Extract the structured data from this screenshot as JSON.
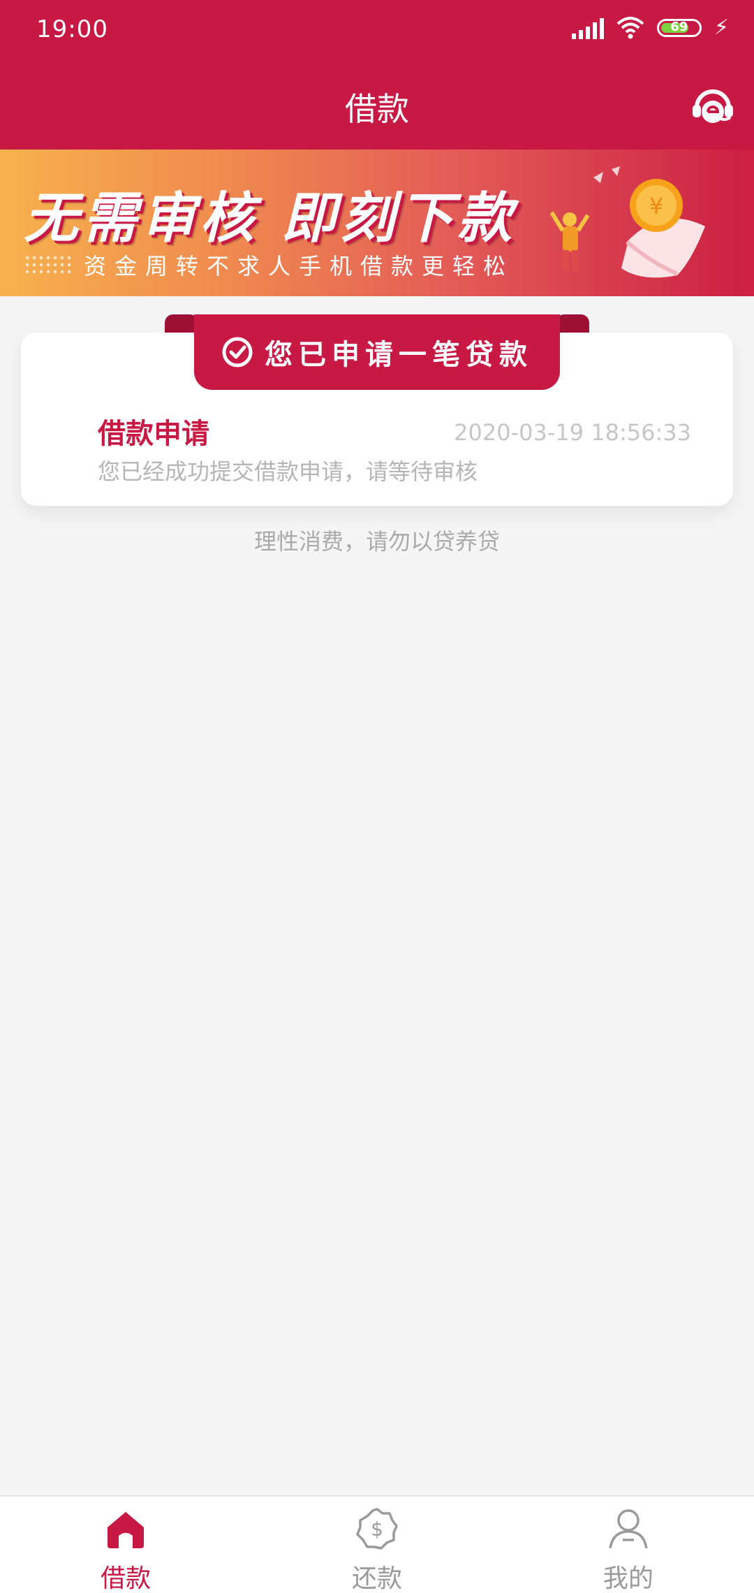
{
  "status_bar": {
    "time": "19:00",
    "battery": "69",
    "icons": [
      "signal-icon",
      "wifi-icon",
      "battery-icon",
      "charging-icon"
    ]
  },
  "header": {
    "title": "借款",
    "right_icon": "customer-service-icon"
  },
  "banner": {
    "title": "无需审核 即刻下款",
    "subtitle": "资金周转不求人手机借款更轻松"
  },
  "status_card": {
    "ribbon_text": "您已申请一笔贷款",
    "item_title": "借款申请",
    "item_time": "2020-03-19 18:56:33",
    "item_desc": "您已经成功提交借款申请，请等待审核"
  },
  "notice": "理性消费，请勿以贷养贷",
  "bottom_nav": {
    "items": [
      {
        "label": "借款",
        "icon": "home-icon",
        "active": true
      },
      {
        "label": "还款",
        "icon": "repay-icon",
        "active": false
      },
      {
        "label": "我的",
        "icon": "user-icon",
        "active": false
      }
    ]
  },
  "colors": {
    "primary": "#c81844",
    "background": "#f5f5f5",
    "muted_text": "#aaaaaa"
  }
}
